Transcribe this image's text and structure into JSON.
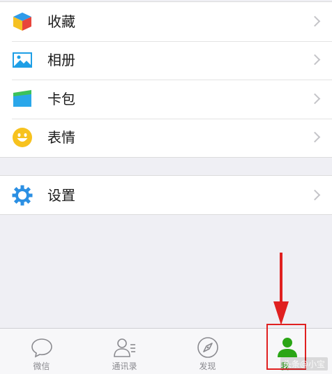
{
  "menu": {
    "group1": [
      {
        "label": "收藏",
        "icon": "favorites-cube-icon"
      },
      {
        "label": "相册",
        "icon": "album-picture-icon"
      },
      {
        "label": "卡包",
        "icon": "card-wallet-icon"
      },
      {
        "label": "表情",
        "icon": "sticker-smiley-icon"
      }
    ],
    "group2": [
      {
        "label": "设置",
        "icon": "settings-gear-icon"
      }
    ]
  },
  "tabbar": {
    "items": [
      {
        "label": "微信",
        "icon": "chat-bubble-icon"
      },
      {
        "label": "通讯录",
        "icon": "contacts-icon"
      },
      {
        "label": "发现",
        "icon": "compass-icon"
      },
      {
        "label": "我",
        "icon": "me-person-icon",
        "active": true
      }
    ]
  },
  "annotation": {
    "highlight_color": "#e02020",
    "target": "我"
  },
  "colors": {
    "active_tab": "#2aa515",
    "inactive_tab": "#8a8a8f",
    "background": "#efeff4"
  },
  "watermark": "头条@小宝"
}
